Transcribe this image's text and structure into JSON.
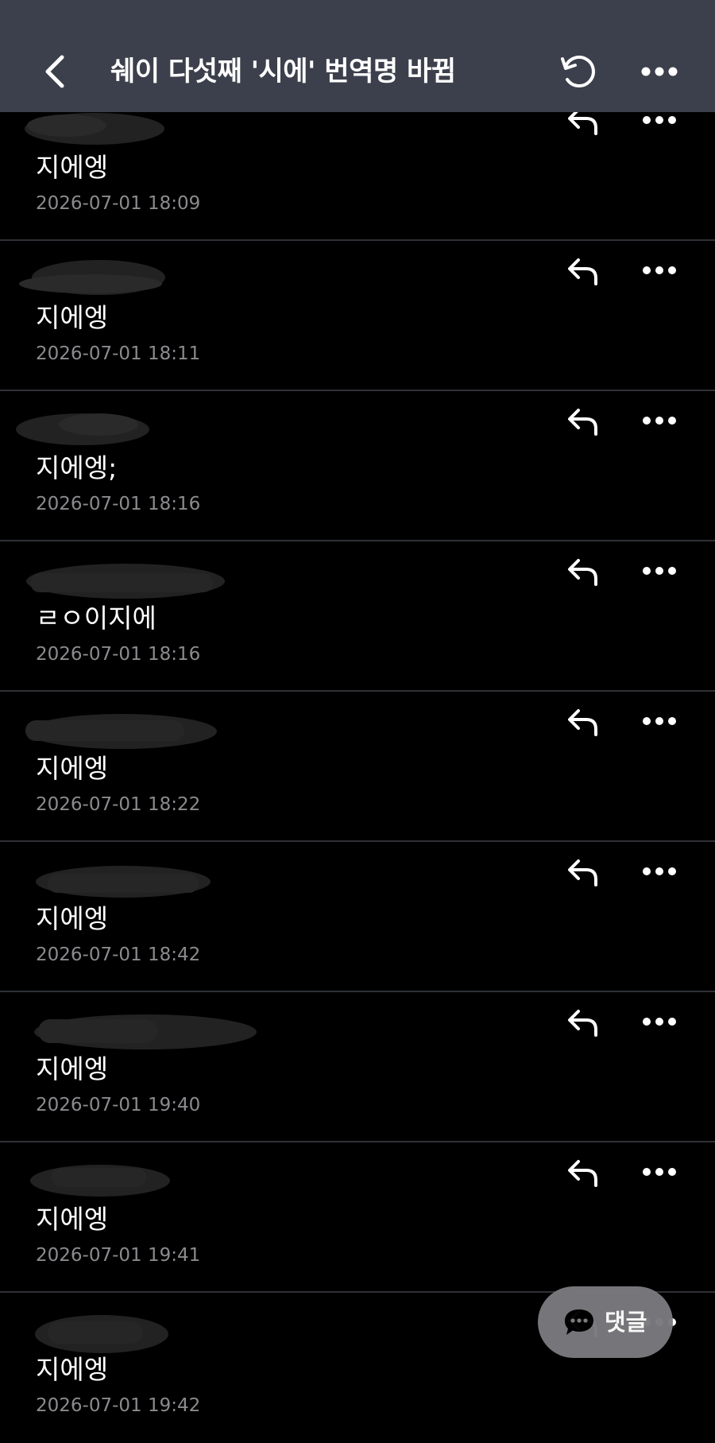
{
  "header": {
    "title": "쉐이 다섯째 '시에' 번역명 바뀜",
    "back_icon": "chevron-left-icon",
    "refresh_icon": "refresh-icon",
    "more_icon": "more-horizontal-icon"
  },
  "comments": [
    {
      "text": "지에엥",
      "date": "2026-07-01 18:09"
    },
    {
      "text": "지에엥",
      "date": "2026-07-01 18:11"
    },
    {
      "text": "지에엥;",
      "date": "2026-07-01 18:16"
    },
    {
      "text": "ㄹㅇ이지에",
      "date": "2026-07-01 18:16"
    },
    {
      "text": "지에엥",
      "date": "2026-07-01 18:22"
    },
    {
      "text": "지에엥",
      "date": "2026-07-01 18:42"
    },
    {
      "text": "지에엥",
      "date": "2026-07-01 19:40"
    },
    {
      "text": "지에엥",
      "date": "2026-07-01 19:41"
    },
    {
      "text": "지에엥",
      "date": "2026-07-01 19:42"
    }
  ],
  "comment_actions": {
    "reply_icon": "reply-icon",
    "more_icon": "more-horizontal-icon"
  },
  "fab": {
    "label": "댓글",
    "icon": "chat-bubble-icon"
  },
  "colors": {
    "header_bg": "#3c404c",
    "background": "#000000",
    "date_text": "#8b8b8f",
    "divider": "#2f3136",
    "fab_bg": "#7a7a7e"
  }
}
